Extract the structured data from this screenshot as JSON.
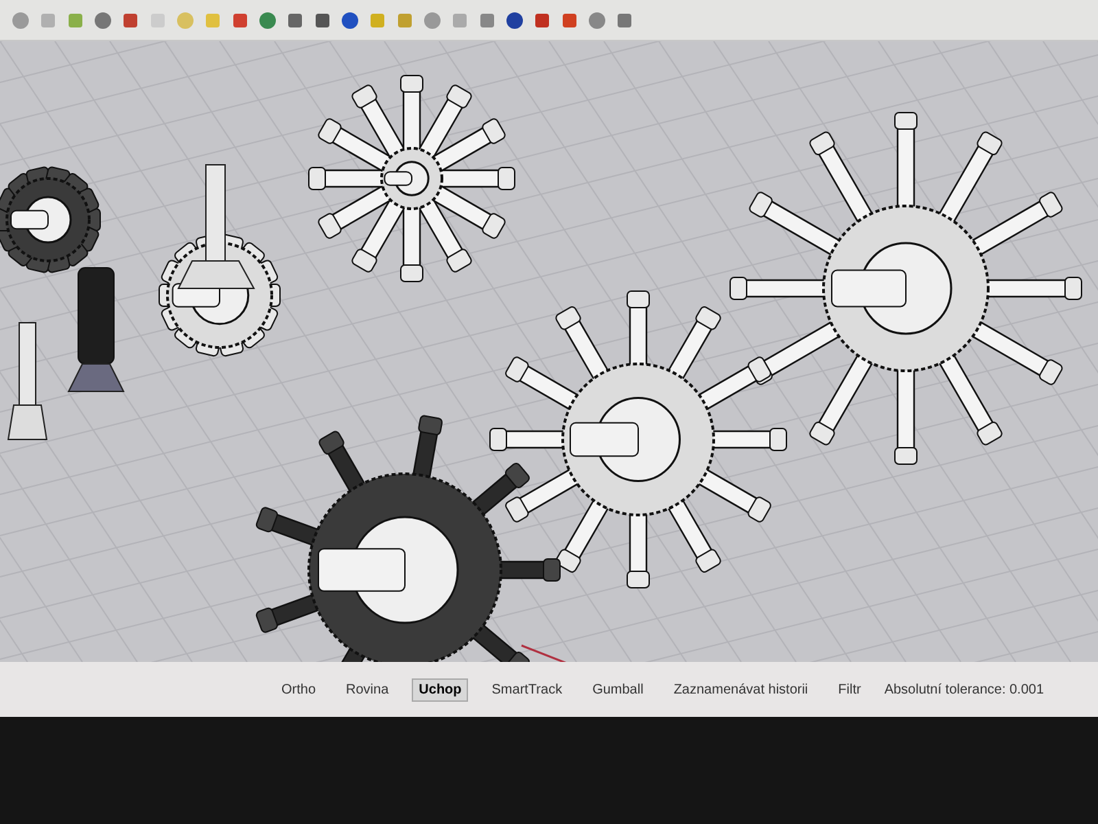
{
  "status_bar": {
    "toggles": [
      {
        "label": "Ortho",
        "selected": false
      },
      {
        "label": "Rovina",
        "selected": false
      },
      {
        "label": "Uchop",
        "selected": true
      },
      {
        "label": "SmartTrack",
        "selected": false
      },
      {
        "label": "Gumball",
        "selected": false
      },
      {
        "label": "Zaznamenávat historii",
        "selected": false
      },
      {
        "label": "Filtr",
        "selected": false
      }
    ],
    "tolerance": "Absolutní tolerance: 0.001"
  }
}
